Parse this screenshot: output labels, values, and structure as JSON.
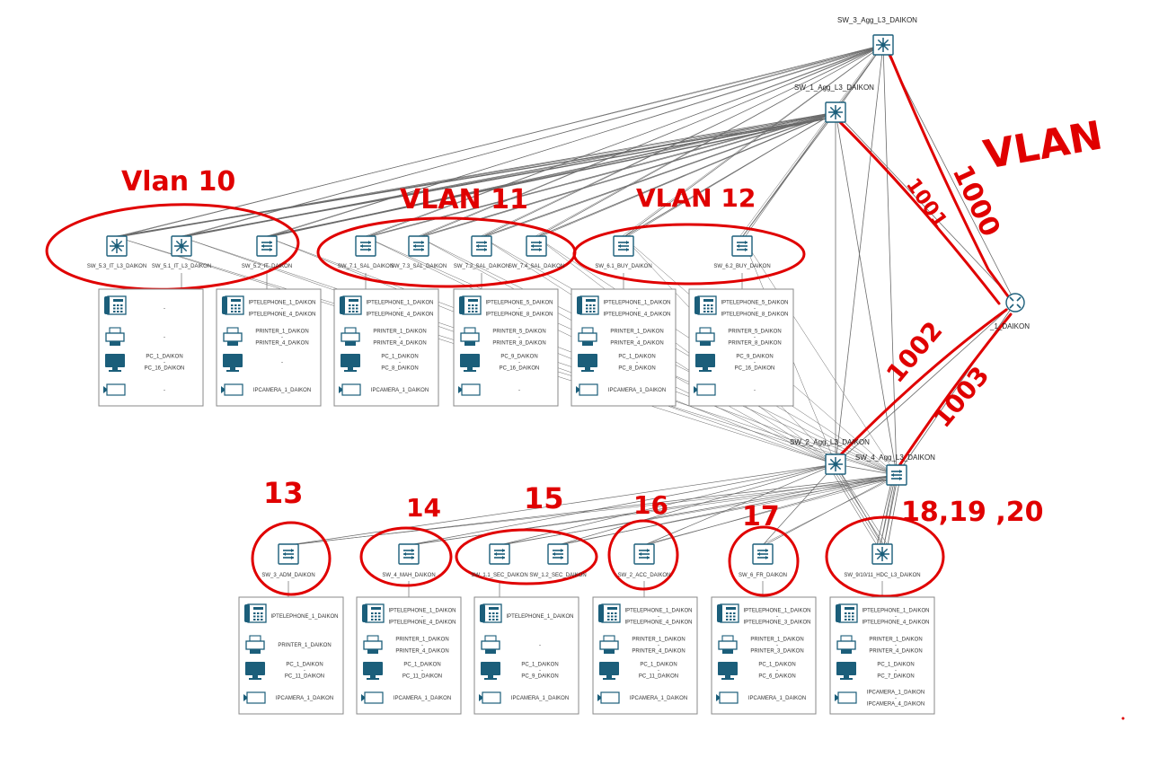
{
  "colors": {
    "line": "#6b6b6b",
    "icon": "#1b5e7a",
    "annotation": "#e00000"
  },
  "core": {
    "sw3": "SW_3_Agg_L3_DAIKON",
    "sw1": "SW_1_Agg_L3_DAIKON",
    "router": "_1_DAIKON",
    "sw2": "SW_2_Agg_L3_DAIKON",
    "sw4": "SW_4_Agg_L3_DAIKON"
  },
  "top_switches": [
    {
      "label": "SW_5.3_IT_L3_DAIKON",
      "icon": "l3-switch-icon"
    },
    {
      "label": "SW_5.1_IT_L3_DAIKON",
      "icon": "l3-switch-icon"
    },
    {
      "label": "SW_5.2_IT_DAIKON",
      "icon": "l2-switch-icon"
    },
    {
      "label": "SW_7.1_SAL_DAIKON",
      "icon": "l2-switch-icon"
    },
    {
      "label": "SW_7.3_SAL_DAIKON",
      "icon": "l2-switch-icon"
    },
    {
      "label": "SW_7.2_SAL_DAIKON",
      "icon": "l2-switch-icon"
    },
    {
      "label": "SW_7.4_SAL_DAIKON",
      "icon": "l2-switch-icon"
    },
    {
      "label": "SW_6.1_BUY_DAIKON",
      "icon": "l2-switch-icon"
    },
    {
      "label": "SW_6.2_BUY_DAIKON",
      "icon": "l2-switch-icon"
    }
  ],
  "top_groups": [
    {
      "phone": [
        "-"
      ],
      "printer": [
        "-"
      ],
      "pc": [
        "PC_1_DAIKON",
        "-",
        "PC_16_DAIKON"
      ],
      "camera": [
        "-"
      ]
    },
    {
      "phone": [
        "IPTELEPHONE_1_DAIKON",
        "-",
        "IPTELEPHONE_4_DAIKON"
      ],
      "printer": [
        "PRINTER_1_DAIKON",
        "-",
        "PRINTER_4_DAIKON"
      ],
      "pc": [
        "-"
      ],
      "camera": [
        "IPCAMERA_1_DAIKON"
      ]
    },
    {
      "phone": [
        "IPTELEPHONE_1_DAIKON",
        "-",
        "IPTELEPHONE_4_DAIKON"
      ],
      "printer": [
        "PRINTER_1_DAIKON",
        "-",
        "PRINTER_4_DAIKON"
      ],
      "pc": [
        "PC_1_DAIKON",
        "-",
        "PC_8_DAIKON"
      ],
      "camera": [
        "IPCAMERA_1_DAIKON"
      ]
    },
    {
      "phone": [
        "IPTELEPHONE_5_DAIKON",
        "-",
        "IPTELEPHONE_8_DAIKON"
      ],
      "printer": [
        "PRINTER_5_DAIKON",
        "-",
        "PRINTER_8_DAIKON"
      ],
      "pc": [
        "PC_9_DAIKON",
        "-",
        "PC_16_DAIKON"
      ],
      "camera": [
        "-"
      ]
    },
    {
      "phone": [
        "IPTELEPHONE_1_DAIKON",
        "-",
        "IPTELEPHONE_4_DAIKON"
      ],
      "printer": [
        "PRINTER_1_DAIKON",
        "-",
        "PRINTER_4_DAIKON"
      ],
      "pc": [
        "PC_1_DAIKON",
        "-",
        "PC_8_DAIKON"
      ],
      "camera": [
        "IPCAMERA_1_DAIKON"
      ]
    },
    {
      "phone": [
        "IPTELEPHONE_5_DAIKON",
        "-",
        "IPTELEPHONE_8_DAIKON"
      ],
      "printer": [
        "PRINTER_5_DAIKON",
        "-",
        "PRINTER_8_DAIKON"
      ],
      "pc": [
        "PC_9_DAIKON",
        "-",
        "PC_16_DAIKON"
      ],
      "camera": [
        "-"
      ]
    }
  ],
  "bottom_switches": [
    {
      "label": "SW_3_ADM_DAIKON",
      "icon": "l2-switch-icon"
    },
    {
      "label": "SW_4_MAH_DAIKON",
      "icon": "l2-switch-icon"
    },
    {
      "label": "SW_1.1_SEC_DAIKON",
      "icon": "l2-switch-icon"
    },
    {
      "label": "SW_1.2_SEC_DAIKON",
      "icon": "l2-switch-icon"
    },
    {
      "label": "SW_2_ACC_DAIKON",
      "icon": "l2-switch-icon"
    },
    {
      "label": "SW_6_FR_DAIKON",
      "icon": "l2-switch-icon"
    },
    {
      "label": "SW_9/10/11_HDC_L3_DAIKON",
      "icon": "l3-switch-icon"
    }
  ],
  "bottom_groups": [
    {
      "phone": [
        "IPTELEPHONE_1_DAIKON"
      ],
      "printer": [
        "PRINTER_1_DAIKON"
      ],
      "pc": [
        "PC_1_DAIKON",
        "-",
        "PC_11_DAIKON"
      ],
      "camera": [
        "IPCAMERA_1_DAIKON"
      ]
    },
    {
      "phone": [
        "IPTELEPHONE_1_DAIKON",
        "-",
        "IPTELEPHONE_4_DAIKON"
      ],
      "printer": [
        "PRINTER_1_DAIKON",
        "-",
        "PRINTER_4_DAIKON"
      ],
      "pc": [
        "PC_1_DAIKON",
        "-",
        "PC_11_DAIKON"
      ],
      "camera": [
        "IPCAMERA_1_DAIKON"
      ]
    },
    {
      "phone": [
        "IPTELEPHONE_1_DAIKON"
      ],
      "printer": [
        "-"
      ],
      "pc": [
        "PC_1_DAIKON",
        "-",
        "PC_9_DAIKON"
      ],
      "camera": [
        "IPCAMERA_1_DAIKON"
      ]
    },
    {
      "phone": [
        "IPTELEPHONE_1_DAIKON",
        "-",
        "IPTELEPHONE_4_DAIKON"
      ],
      "printer": [
        "PRINTER_1_DAIKON",
        "-",
        "PRINTER_4_DAIKON"
      ],
      "pc": [
        "PC_1_DAIKON",
        "-",
        "PC_11_DAIKON"
      ],
      "camera": [
        "IPCAMERA_1_DAIKON"
      ]
    },
    {
      "phone": [
        "IPTELEPHONE_1_DAIKON",
        "-",
        "IPTELEPHONE_3_DAIKON"
      ],
      "printer": [
        "PRINTER_1_DAIKON",
        "-",
        "PRINTER_3_DAIKON"
      ],
      "pc": [
        "PC_1_DAIKON",
        "-",
        "PC_6_DAIKON"
      ],
      "camera": [
        "IPCAMERA_1_DAIKON"
      ]
    },
    {
      "phone": [
        "IPTELEPHONE_1_DAIKON",
        "-",
        "IPTELEPHONE_4_DAIKON"
      ],
      "printer": [
        "PRINTER_1_DAIKON",
        "-",
        "PRINTER_4_DAIKON"
      ],
      "pc": [
        "PC_1_DAIKON",
        "-",
        "PC_7_DAIKON"
      ],
      "camera": [
        "IPCAMERA_1_DAIKON",
        "-",
        "IPCAMERA_4_DAIKON"
      ]
    }
  ],
  "annotations": {
    "vlan10": "Vlan 10",
    "vlan11": "VLAN 11",
    "vlan12": "VLAN 12",
    "vlan_right": "VLAN",
    "n1000": "1000",
    "n1001": "1001",
    "n1002": "1002",
    "n1003": "1003",
    "v13": "13",
    "v14": "14",
    "v15": "15",
    "v16": "16",
    "v17": "17",
    "v18": "18,19 ,20"
  }
}
